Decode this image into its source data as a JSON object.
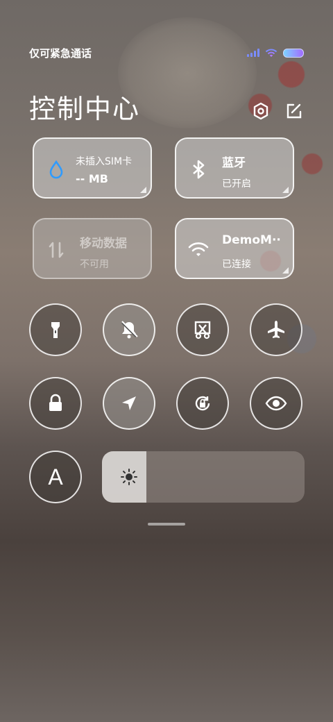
{
  "status_bar": {
    "carrier_text": "仅可紧急通话"
  },
  "header": {
    "title": "控制中心",
    "icons": [
      "settings-icon",
      "edit-icon"
    ]
  },
  "tiles": {
    "data_usage": {
      "label": "未插入SIM卡",
      "value": "-- MB",
      "icon": "water-drop-icon"
    },
    "bluetooth": {
      "label": "蓝牙",
      "status": "已开启",
      "icon": "bluetooth-icon"
    },
    "mobile_data": {
      "label": "移动数据",
      "status": "不可用",
      "icon": "data-arrows-icon"
    },
    "wifi": {
      "label": "DemoM··",
      "status": "已连接",
      "icon": "wifi-icon"
    }
  },
  "toggles_row1": [
    {
      "name": "flashlight",
      "state": "off"
    },
    {
      "name": "silent",
      "state": "on"
    },
    {
      "name": "screenshot",
      "state": "off"
    },
    {
      "name": "airplane",
      "state": "off"
    }
  ],
  "toggles_row2": [
    {
      "name": "lock",
      "state": "off"
    },
    {
      "name": "location",
      "state": "on"
    },
    {
      "name": "auto-rotate-lock",
      "state": "off"
    },
    {
      "name": "reading-mode",
      "state": "off"
    }
  ],
  "font_toggle": {
    "letter": "A"
  },
  "brightness": {
    "level": 0.22
  },
  "colors": {
    "accent_blue": "#2f9bff",
    "tile_bg": "#d2d2d2"
  }
}
